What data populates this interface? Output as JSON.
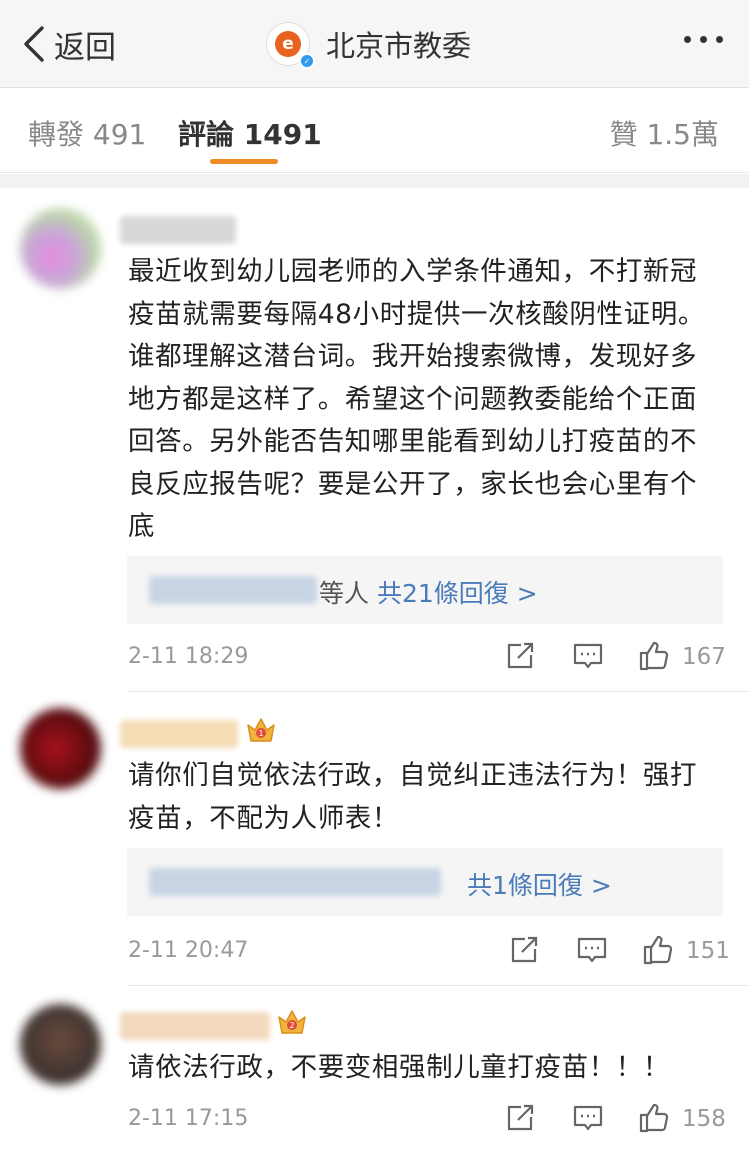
{
  "nav": {
    "back_label": "返回",
    "title": "北京市教委",
    "logo_icon": "beijing-education-logo",
    "more_icon": "more-dots-icon"
  },
  "tabs": {
    "repost": "轉發 491",
    "comments": "評論 1491",
    "likes": "贊 1.5萬",
    "accent": "#f08a24"
  },
  "comments": [
    {
      "text": "最近收到幼儿园老师的入学条件通知，不打新冠疫苗就需要每隔48小时提供一次核酸阴性证明。谁都理解这潜台词。我开始搜索微博，发现好多地方都是这样了。希望这个问题教委能给个正面回答。另外能否告知哪里能看到幼儿打疫苗的不良反应报告呢？要是公开了，家长也会心里有个底",
      "reply_suffix": "等人",
      "reply_count": "共21條回復 >",
      "time": "2-11 18:29",
      "likes": "167"
    },
    {
      "text": "请你们自觉依法行政，自觉纠正违法行为！强打疫苗，不配为人师表！",
      "reply_suffix": "",
      "reply_count": "共1條回復 >",
      "time": "2-11 20:47",
      "likes": "151"
    },
    {
      "text": "请依法行政，不要变相强制儿童打疫苗！！！",
      "time": "2-11 17:15",
      "likes": "158"
    }
  ],
  "colors": {
    "reply_link": "#4a7cb8",
    "meta": "#999999",
    "nav_bg": "#f6f6f6"
  }
}
